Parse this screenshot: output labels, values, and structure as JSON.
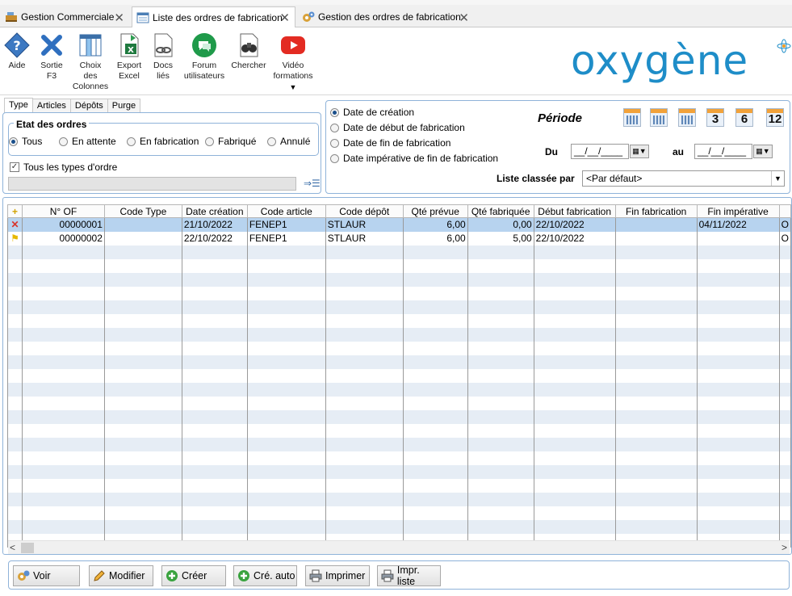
{
  "tabs": [
    {
      "label": "Gestion Commerciale",
      "active": false
    },
    {
      "label": "Liste des ordres de fabrication",
      "active": true
    },
    {
      "label": "Gestion des ordres de fabrication",
      "active": false
    }
  ],
  "toolbar": {
    "items": [
      {
        "line1": "Aide",
        "line2": "",
        "line3": "",
        "icon": "help-diamond-icon"
      },
      {
        "line1": "Sortie",
        "line2": "F3",
        "line3": "",
        "icon": "exit-x-icon"
      },
      {
        "line1": "Choix",
        "line2": "des",
        "line3": "Colonnes",
        "icon": "columns-icon"
      },
      {
        "line1": "Export",
        "line2": "Excel",
        "line3": "",
        "icon": "excel-icon"
      },
      {
        "line1": "Docs",
        "line2": "liés",
        "line3": "",
        "icon": "linked-docs-icon"
      },
      {
        "line1": "Forum",
        "line2": "utilisateurs",
        "line3": "",
        "icon": "forum-icon"
      },
      {
        "line1": "Chercher",
        "line2": "",
        "line3": "",
        "icon": "binoculars-icon"
      },
      {
        "line1": "Vidéo",
        "line2": "formations",
        "line3": "",
        "icon": "youtube-icon"
      }
    ],
    "logo": "oxygène"
  },
  "filter_tabs": [
    "Type",
    "Articles",
    "Dépôts",
    "Purge"
  ],
  "etat": {
    "title": "Etat des ordres",
    "options": [
      "Tous",
      "En attente",
      "En fabrication",
      "Fabriqué",
      "Annulé"
    ],
    "selected": "Tous"
  },
  "tous_types_label": "Tous les types d'ordre",
  "date_options": [
    "Date de création",
    "Date de début de fabrication",
    "Date de fin de fabrication",
    "Date impérative de fin de fabrication"
  ],
  "periode": {
    "title": "Période",
    "buttons": [
      "",
      "",
      "",
      "3",
      "6",
      "12"
    ],
    "du_label": "Du",
    "au_label": "au",
    "du_value": "__/__/____",
    "au_value": "__/__/____"
  },
  "liste_classee": {
    "label": "Liste classée par",
    "value": "<Par défaut>"
  },
  "grid": {
    "columns": [
      "",
      "N° OF",
      "Code Type",
      "Date création",
      "Code article",
      "Code dépôt",
      "Qté prévue",
      "Qté fabriquée",
      "Début fabrication",
      "Fin fabrication",
      "Fin impérative",
      ""
    ],
    "rows": [
      {
        "status": "cancelled-x-icon",
        "num": "00000001",
        "type": "",
        "date": "21/10/2022",
        "article": "FENEP1",
        "depot": "STLAUR",
        "prevue": "6,00",
        "fabriquee": "0,00",
        "debut": "22/10/2022",
        "fin": "",
        "imperative": "04/11/2022",
        "extra": "O"
      },
      {
        "status": "flag-icon",
        "num": "00000002",
        "type": "",
        "date": "22/10/2022",
        "article": "FENEP1",
        "depot": "STLAUR",
        "prevue": "6,00",
        "fabriquee": "5,00",
        "debut": "22/10/2022",
        "fin": "",
        "imperative": "",
        "extra": "O"
      }
    ]
  },
  "buttons": [
    "Voir",
    "Modifier",
    "Créer",
    "Cré. auto",
    "Imprimer",
    "Impr. liste"
  ]
}
